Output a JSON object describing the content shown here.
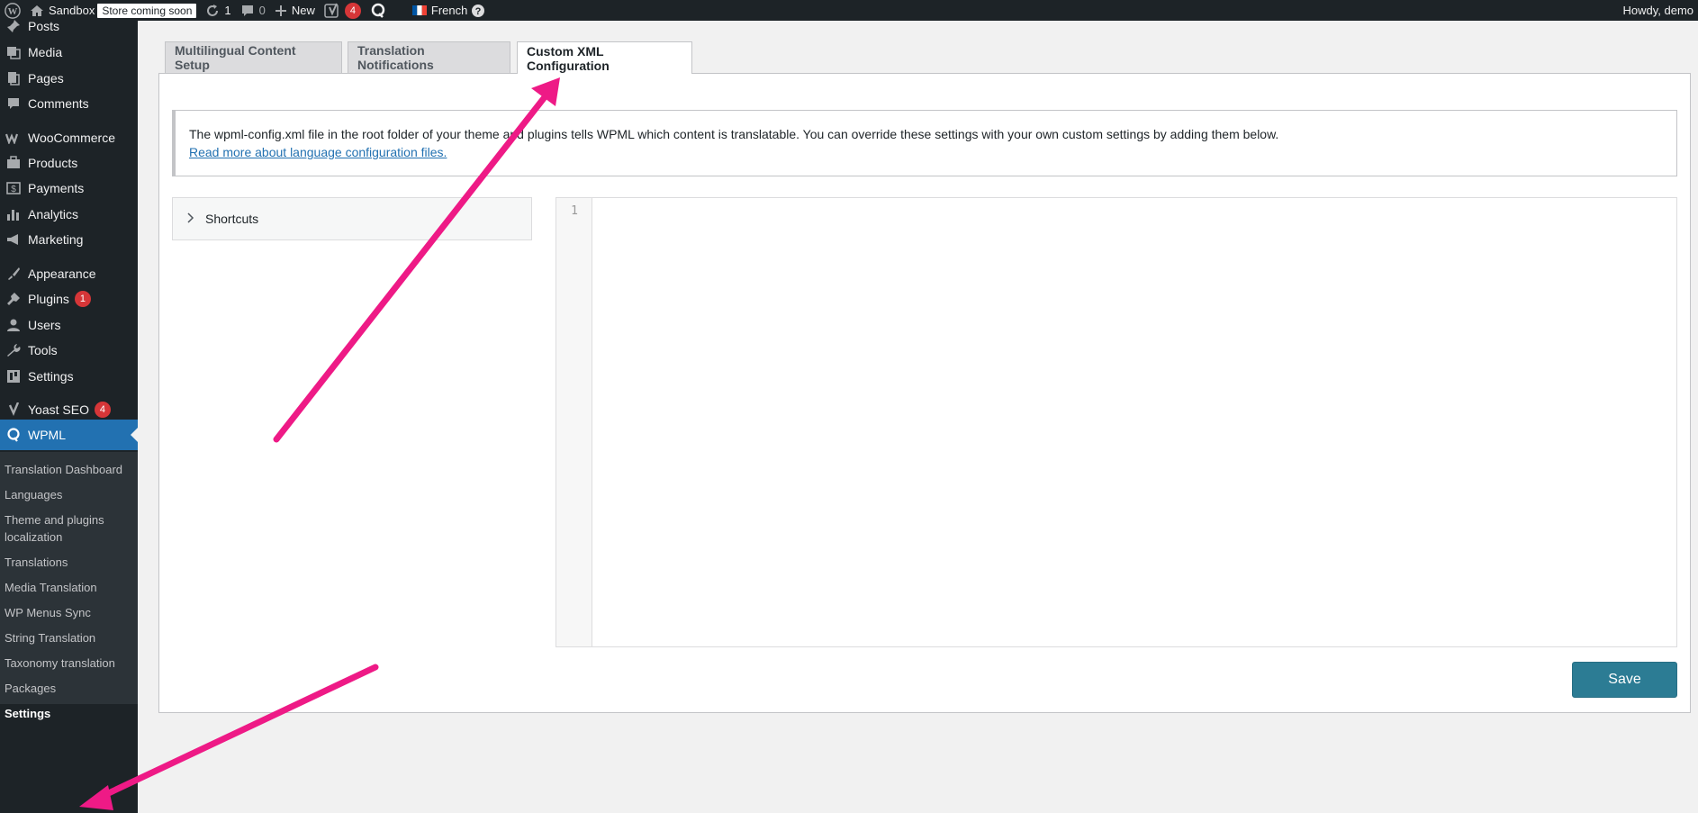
{
  "admin_bar": {
    "site_name": "Sandbox",
    "store_badge": "Store coming soon",
    "updates_count": "1",
    "comments_count": "0",
    "new_label": "New",
    "yoast_count": "4",
    "language": "French",
    "howdy": "Howdy, demo"
  },
  "sidebar": {
    "items": [
      {
        "label": "Posts",
        "icon": "pin-icon"
      },
      {
        "label": "Media",
        "icon": "media-icon"
      },
      {
        "label": "Pages",
        "icon": "pages-icon"
      },
      {
        "label": "Comments",
        "icon": "comments-icon"
      },
      {
        "label": "WooCommerce",
        "icon": "woocommerce-icon"
      },
      {
        "label": "Products",
        "icon": "products-icon"
      },
      {
        "label": "Payments",
        "icon": "payments-icon"
      },
      {
        "label": "Analytics",
        "icon": "analytics-icon"
      },
      {
        "label": "Marketing",
        "icon": "marketing-icon"
      },
      {
        "label": "Appearance",
        "icon": "appearance-icon"
      },
      {
        "label": "Plugins",
        "icon": "plugins-icon",
        "badge": "1"
      },
      {
        "label": "Users",
        "icon": "users-icon"
      },
      {
        "label": "Tools",
        "icon": "tools-icon"
      },
      {
        "label": "Settings",
        "icon": "settings-icon"
      },
      {
        "label": "Yoast SEO",
        "icon": "yoast-icon",
        "badge": "4"
      },
      {
        "label": "WPML",
        "icon": "wpml-icon"
      }
    ],
    "submenu": [
      "Translation Dashboard",
      "Languages",
      "Theme and plugins localization",
      "Translations",
      "Media Translation",
      "WP Menus Sync",
      "String Translation",
      "Taxonomy translation",
      "Packages",
      "Settings"
    ]
  },
  "tabs": [
    {
      "label": "Multilingual Content Setup"
    },
    {
      "label": "Translation Notifications"
    },
    {
      "label": "Custom XML Configuration"
    }
  ],
  "notice": {
    "text": "The wpml-config.xml file in the root folder of your theme and plugins tells WPML which content is translatable. You can override these settings with your own custom settings by adding them below.",
    "link": "Read more about language configuration files."
  },
  "shortcuts": {
    "label": "Shortcuts"
  },
  "editor": {
    "line_number": "1"
  },
  "save_button": {
    "label": "Save"
  },
  "colors": {
    "admin_bar_bg": "#1d2327",
    "menu_active": "#2271b1",
    "save_button": "#2c7c94",
    "arrow": "#ee1a86",
    "badge": "#d63638"
  }
}
